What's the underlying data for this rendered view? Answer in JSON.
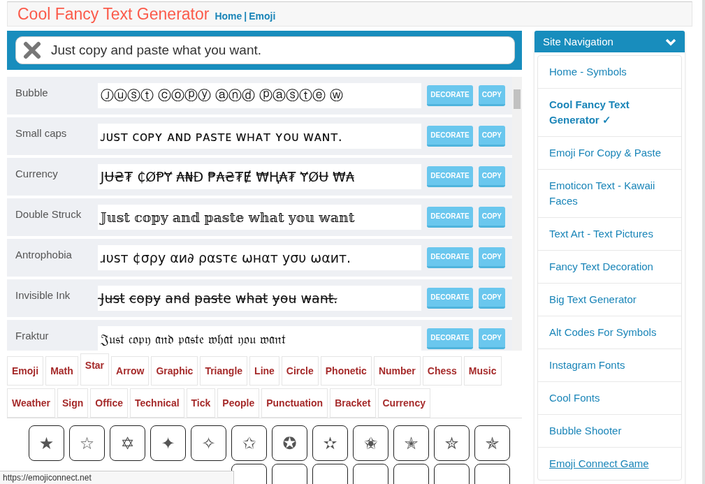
{
  "header": {
    "title": "Cool Fancy Text Generator",
    "links": [
      {
        "label": "Home"
      },
      {
        "label": "Emoji"
      }
    ],
    "separator": "|"
  },
  "input": {
    "value": "Just copy and paste what you want."
  },
  "styles": [
    {
      "name": "Bubble",
      "text": "Ⓙⓤⓢⓣ ⓒⓞⓟⓨ ⓐⓝⓓ ⓟⓐⓢⓣⓔ ⓦ",
      "kind": "sans",
      "decorate": "DECORATE",
      "copy": "COPY"
    },
    {
      "name": "Small caps",
      "text": "ᴊᴜsᴛ ᴄᴏᴘʏ ᴀɴᴅ ᴘᴀsᴛᴇ ᴡʜᴀᴛ ʏᴏᴜ ᴡᴀɴᴛ.",
      "kind": "sans",
      "decorate": "DECORATE",
      "copy": "COPY"
    },
    {
      "name": "Currency",
      "text": "JɄ₴₮ ₵ØⱣɎ ₳₦Đ ₱₳₴₮Ɇ ₩Ⱨ₳₮ ɎØɄ ₩₳",
      "kind": "sans",
      "decorate": "DECORATE",
      "copy": "COPY"
    },
    {
      "name": "Double Struck",
      "text": "𝕁𝕦𝕤𝕥 𝕔𝕠𝕡𝕪 𝕒𝕟𝕕 𝕡𝕒𝕤𝕥𝕖 𝕨𝕙𝕒𝕥 𝕪𝕠𝕦 𝕨𝕒𝕟𝕥",
      "kind": "serif",
      "decorate": "DECORATE",
      "copy": "COPY"
    },
    {
      "name": "Antrophobia",
      "text": "ɹυѕт ¢σρу αи∂ ραѕтє ωнαт уσυ ωαит.",
      "kind": "sans",
      "decorate": "DECORATE",
      "copy": "COPY"
    },
    {
      "name": "Invisible Ink",
      "text": "J̴u̴s̴t̴ c̴o̴p̴y̴ a̴n̴d̴ p̴a̴s̴t̴e̴ w̴h̴a̴t̴ y̴o̴u̴ w̴a̴n̴t̴.̴",
      "kind": "sans",
      "decorate": "DECORATE",
      "copy": "COPY"
    },
    {
      "name": "Fraktur",
      "text": "𝔍𝔲𝔰𝔱 𝔠𝔬𝔭𝔶 𝔞𝔫𝔡 𝔭𝔞𝔰𝔱𝔢 𝔴𝔥𝔞𝔱 𝔶𝔬𝔲 𝔴𝔞𝔫𝔱",
      "kind": "serif",
      "decorate": "DECORATE",
      "copy": "COPY"
    }
  ],
  "tab_rows": [
    [
      {
        "label": "Emoji",
        "selected": false
      },
      {
        "label": "Math",
        "selected": false
      },
      {
        "label": "Star",
        "selected": true
      },
      {
        "label": "Arrow",
        "selected": false
      },
      {
        "label": "Graphic",
        "selected": false
      },
      {
        "label": "Triangle",
        "selected": false
      },
      {
        "label": "Line",
        "selected": false
      },
      {
        "label": "Circle",
        "selected": false
      },
      {
        "label": "Phonetic",
        "selected": false
      },
      {
        "label": "Number",
        "selected": false
      },
      {
        "label": "Chess",
        "selected": false
      },
      {
        "label": "Music",
        "selected": false
      }
    ],
    [
      {
        "label": "Weather",
        "selected": false
      },
      {
        "label": "Sign",
        "selected": false
      },
      {
        "label": "Office",
        "selected": false
      },
      {
        "label": "Technical",
        "selected": false
      },
      {
        "label": "Tick",
        "selected": false
      },
      {
        "label": "People",
        "selected": false
      },
      {
        "label": "Punctuation",
        "selected": false
      },
      {
        "label": "Bracket",
        "selected": false
      },
      {
        "label": "Currency",
        "selected": false
      }
    ]
  ],
  "symbols": [
    [
      "★",
      "☆",
      "✡",
      "✦",
      "✧",
      "✩",
      "✪",
      "✫",
      "✬",
      "✭",
      "✮",
      "✯"
    ],
    [
      {
        "kind": "covered"
      },
      {
        "kind": "covered"
      },
      {
        "kind": "covered"
      },
      {
        "kind": "covered"
      },
      {
        "kind": "covered"
      },
      {
        "kind": "cut"
      },
      {
        "kind": "cut"
      },
      {
        "kind": "cut"
      },
      {
        "kind": "cut"
      },
      {
        "kind": "cut"
      },
      {
        "kind": "cut"
      },
      {
        "kind": "cut"
      }
    ]
  ],
  "sidebar": {
    "title": "Site Navigation",
    "items": [
      {
        "label": "Home - Symbols",
        "selected": false,
        "hovered": false
      },
      {
        "label": "Cool Fancy Text Generator ✓",
        "selected": true,
        "hovered": false
      },
      {
        "label": "Emoji For Copy & Paste",
        "selected": false,
        "hovered": false
      },
      {
        "label": "Emoticon Text - Kawaii Faces",
        "selected": false,
        "hovered": false
      },
      {
        "label": "Text Art - Text Pictures",
        "selected": false,
        "hovered": false
      },
      {
        "label": "Fancy Text Decoration",
        "selected": false,
        "hovered": false
      },
      {
        "label": "Big Text Generator",
        "selected": false,
        "hovered": false
      },
      {
        "label": "Alt Codes For Symbols",
        "selected": false,
        "hovered": false
      },
      {
        "label": "Instagram Fonts",
        "selected": false,
        "hovered": false
      },
      {
        "label": "Cool Fonts",
        "selected": false,
        "hovered": false
      },
      {
        "label": "Bubble Shooter",
        "selected": false,
        "hovered": false
      },
      {
        "label": "Emoji Connect Game",
        "selected": false,
        "hovered": true
      }
    ]
  },
  "status_url": "https://emojiconnect.net"
}
